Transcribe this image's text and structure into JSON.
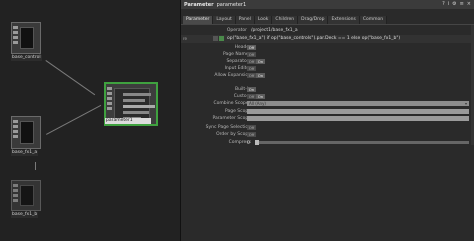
{
  "network": {
    "nodes": [
      {
        "id": "base_control",
        "label": "base_control",
        "selected": false
      },
      {
        "id": "parameter1",
        "label": "parameter1",
        "selected": true
      },
      {
        "id": "base_fx1_a",
        "label": "base_fx1_a",
        "selected": false
      },
      {
        "id": "base_fx1_b",
        "label": "base_fx1_b",
        "selected": false
      }
    ]
  },
  "panel": {
    "title": "Parameter",
    "op_name": "parameter1",
    "icons": [
      "help-icon",
      "info-icon",
      "settings-icon",
      "menu-icon",
      "close-icon"
    ],
    "tabs": [
      "Parameter",
      "Layout",
      "Panel",
      "Look",
      "Children",
      "Drag/Drop",
      "Extensions",
      "Common"
    ],
    "active_tab": "Parameter",
    "operator_label": "Operator",
    "operator_value": "/project1/base_fx1_a",
    "expr_tag": "re",
    "expression": "op(\"base_fx1_a\") if op(\"base_controls\").par.Deck == 1 else op(\"base_fx1_b\")",
    "params": [
      {
        "label": "Header",
        "value": "Off"
      },
      {
        "label": "Page Names",
        "value": "Off"
      },
      {
        "label": "Separators",
        "value": "On"
      },
      {
        "label": "Input Editor",
        "value": "Off"
      },
      {
        "label": "Allow Expansion",
        "value": "On"
      },
      {
        "label": "Built-In",
        "value": "On"
      },
      {
        "label": "Custom",
        "value": "On"
      },
      {
        "label": "Combine Scopes",
        "value": "All (Any)"
      },
      {
        "label": "Page Scope",
        "value": ""
      },
      {
        "label": "Parameter Scope",
        "value": ""
      },
      {
        "label": "Sync Page Selection",
        "value": "Off"
      },
      {
        "label": "Order by Scope",
        "value": "Off"
      },
      {
        "label": "Compress",
        "value": "0"
      }
    ],
    "toggle_off": "Off",
    "toggle_on": "On"
  }
}
